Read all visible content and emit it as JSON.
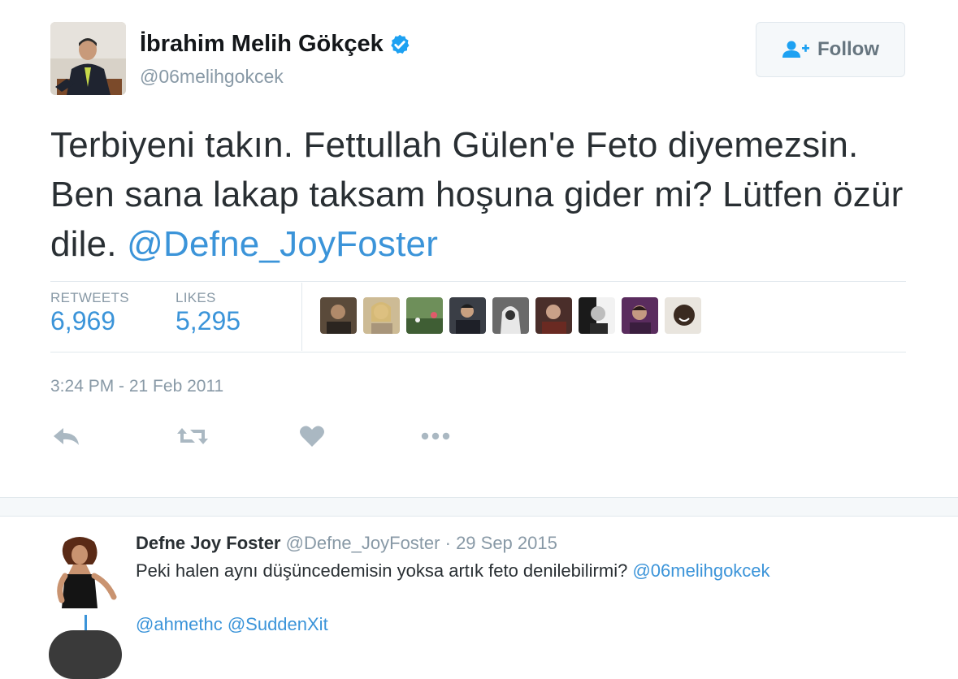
{
  "profile": {
    "display_name": "İbrahim Melih Gökçek",
    "handle": "@06melihgokcek",
    "verified": true,
    "avatar_icon": "profile-photo"
  },
  "follow_button": {
    "label": "Follow",
    "icon": "add-user-icon"
  },
  "tweet": {
    "text": "Terbiyeni takın. Fettullah Gülen'e Feto diyemezsin. Ben sana lakap taksam hoşuna gider mi? Lütfen özür dile.",
    "mention": "@Defne_JoyFoster",
    "timestamp": "3:24 PM - 21 Feb 2011"
  },
  "stats": {
    "retweets_label": "RETWEETS",
    "retweets_value": "6,969",
    "likes_label": "LIKES",
    "likes_value": "5,295"
  },
  "actions": [
    "reply-icon",
    "retweet-icon",
    "like-icon",
    "more-icon"
  ],
  "reply": {
    "name": "Defne Joy Foster",
    "handle": "@Defne_JoyFoster",
    "separator": "·",
    "date": "29 Sep 2015",
    "text": "Peki halen aynı düşüncedemisin yoksa artık feto denilebilirmi?",
    "mention": "@06melihgokcek",
    "mentions_line": "@ahmethc @SuddenXit"
  },
  "colors": {
    "link": "#3b94d9",
    "secondary_text": "#8899a6",
    "primary_text": "#292f33",
    "verified": "#1da1f2"
  }
}
